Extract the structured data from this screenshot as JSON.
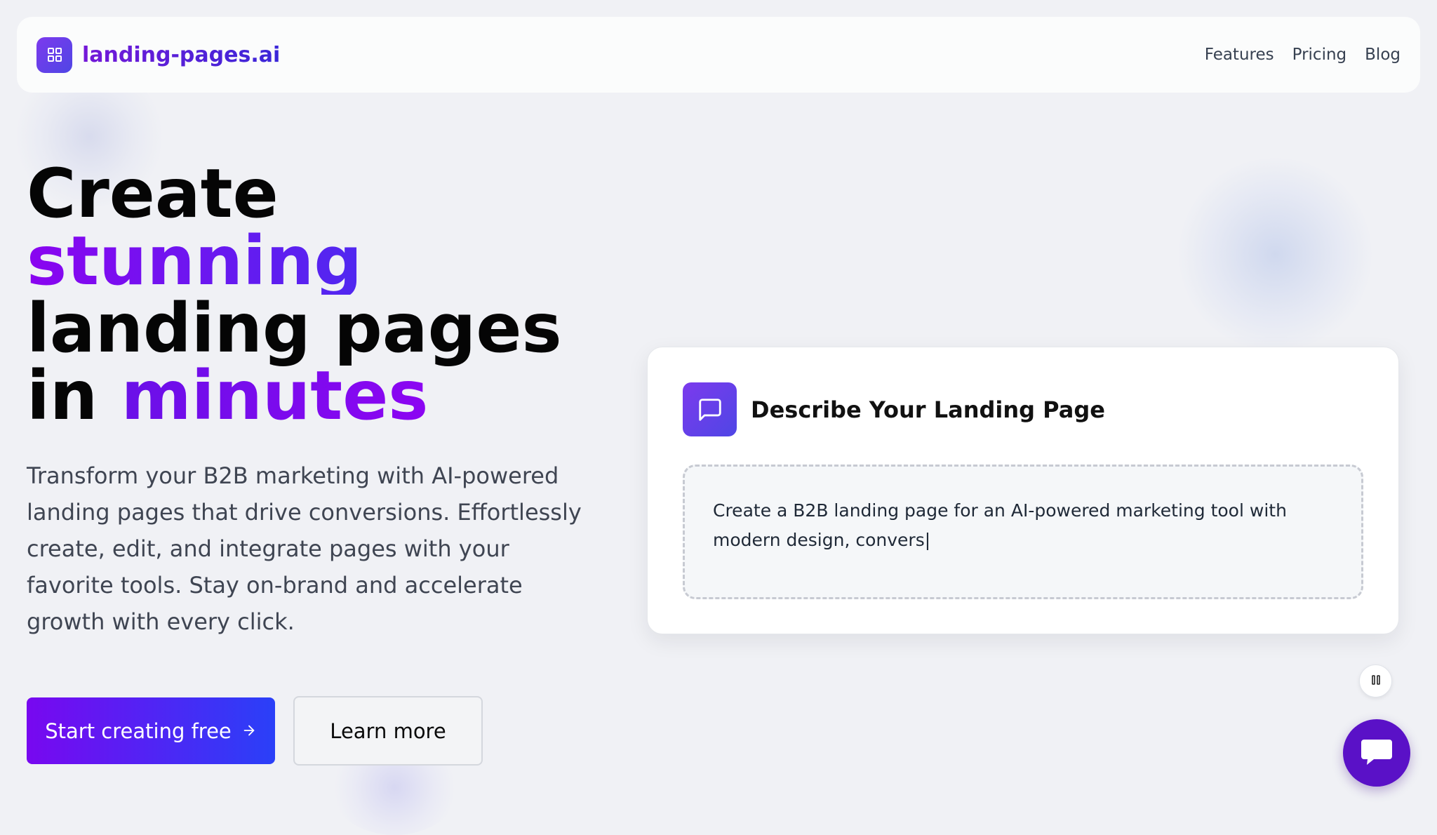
{
  "header": {
    "logo_text": "landing-pages.ai",
    "nav": [
      "Features",
      "Pricing",
      "Blog"
    ]
  },
  "hero": {
    "title_line1": "Create",
    "title_line2": "stunning",
    "title_line3": "landing pages",
    "title_line4_a": "in ",
    "title_line4_b": "minutes",
    "subtitle": "Transform your B2B marketing with AI-powered landing pages that drive conversions. Effortlessly create, edit, and integrate pages with your favorite tools. Stay on-brand and accelerate growth with every click.",
    "primary_cta": "Start creating free",
    "secondary_cta": "Learn more"
  },
  "card": {
    "title": "Describe Your Landing Page",
    "prompt_text": "Create a B2B landing page for an AI-powered marketing tool with modern design, convers|"
  },
  "icons": {
    "logo": "grid-icon",
    "card": "message-square-icon",
    "cta": "arrow-right-icon",
    "pause": "pause-icon",
    "chat": "chat-bubble-icon"
  },
  "colors": {
    "accent_purple": "#7c3aed",
    "accent_blue": "#2a40f8",
    "chat_fab": "#5a11c7"
  }
}
